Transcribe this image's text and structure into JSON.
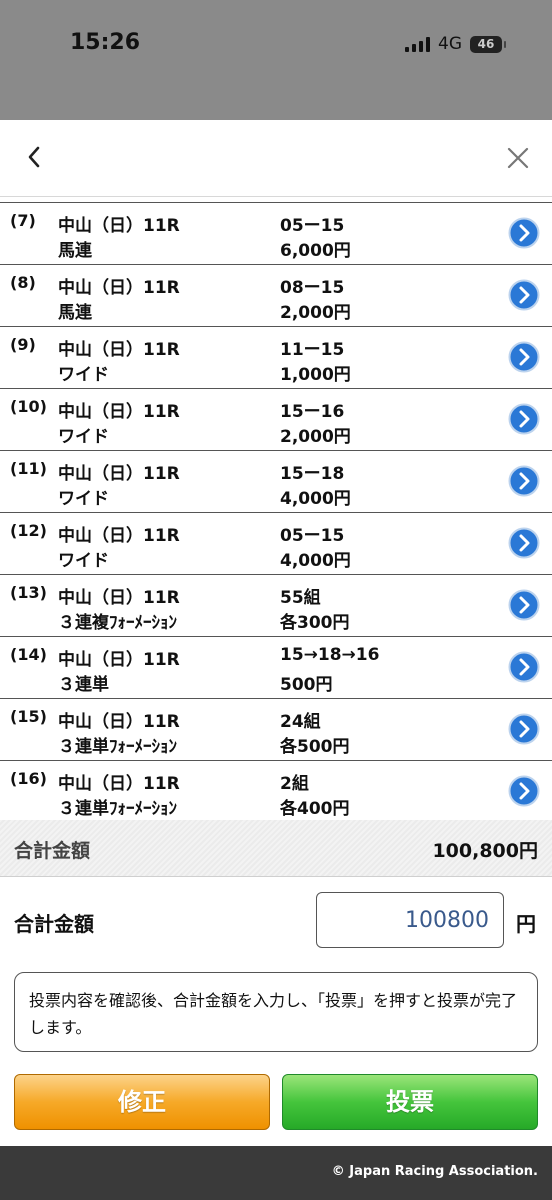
{
  "status": {
    "time": "15:26",
    "network": "4G",
    "battery": "46"
  },
  "rows": [
    {
      "num": "(7)",
      "race": "中山（日）11R",
      "type": "馬連",
      "combo": "05ー15",
      "amount": "6,000円"
    },
    {
      "num": "(8)",
      "race": "中山（日）11R",
      "type": "馬連",
      "combo": "08ー15",
      "amount": "2,000円"
    },
    {
      "num": "(9)",
      "race": "中山（日）11R",
      "type": "ワイド",
      "combo": "11ー15",
      "amount": "1,000円"
    },
    {
      "num": "(10)",
      "race": "中山（日）11R",
      "type": "ワイド",
      "combo": "15ー16",
      "amount": "2,000円"
    },
    {
      "num": "(11)",
      "race": "中山（日）11R",
      "type": "ワイド",
      "combo": "15ー18",
      "amount": "4,000円"
    },
    {
      "num": "(12)",
      "race": "中山（日）11R",
      "type": "ワイド",
      "combo": "05ー15",
      "amount": "4,000円"
    },
    {
      "num": "(13)",
      "race": "中山（日）11R",
      "type": "３連複ﾌｫｰﾒｰｼｮﾝ",
      "combo": "55組",
      "amount": "各300円"
    },
    {
      "num": "(14)",
      "race": "中山（日）11R",
      "type": "３連単",
      "combo": "15→18→16",
      "amount": "500円"
    },
    {
      "num": "(15)",
      "race": "中山（日）11R",
      "type": "３連単ﾌｫｰﾒｰｼｮﾝ",
      "combo": "24組",
      "amount": "各500円"
    },
    {
      "num": "(16)",
      "race": "中山（日）11R",
      "type": "３連単ﾌｫｰﾒｰｼｮﾝ",
      "combo": "2組",
      "amount": "各400円"
    }
  ],
  "total": {
    "label": "合計金額",
    "value": "100,800円"
  },
  "input": {
    "label": "合計金額",
    "value": "100800",
    "unit": "円"
  },
  "notice": "投票内容を確認後、合計金額を入力し、「投票」を押すと投票が完了します。",
  "buttons": {
    "fix": "修正",
    "vote": "投票"
  },
  "footer": "© Japan Racing Association.",
  "colors": {
    "accent_blue": "#2a78d6",
    "orange": "#f6a928",
    "green": "#45c53c"
  }
}
